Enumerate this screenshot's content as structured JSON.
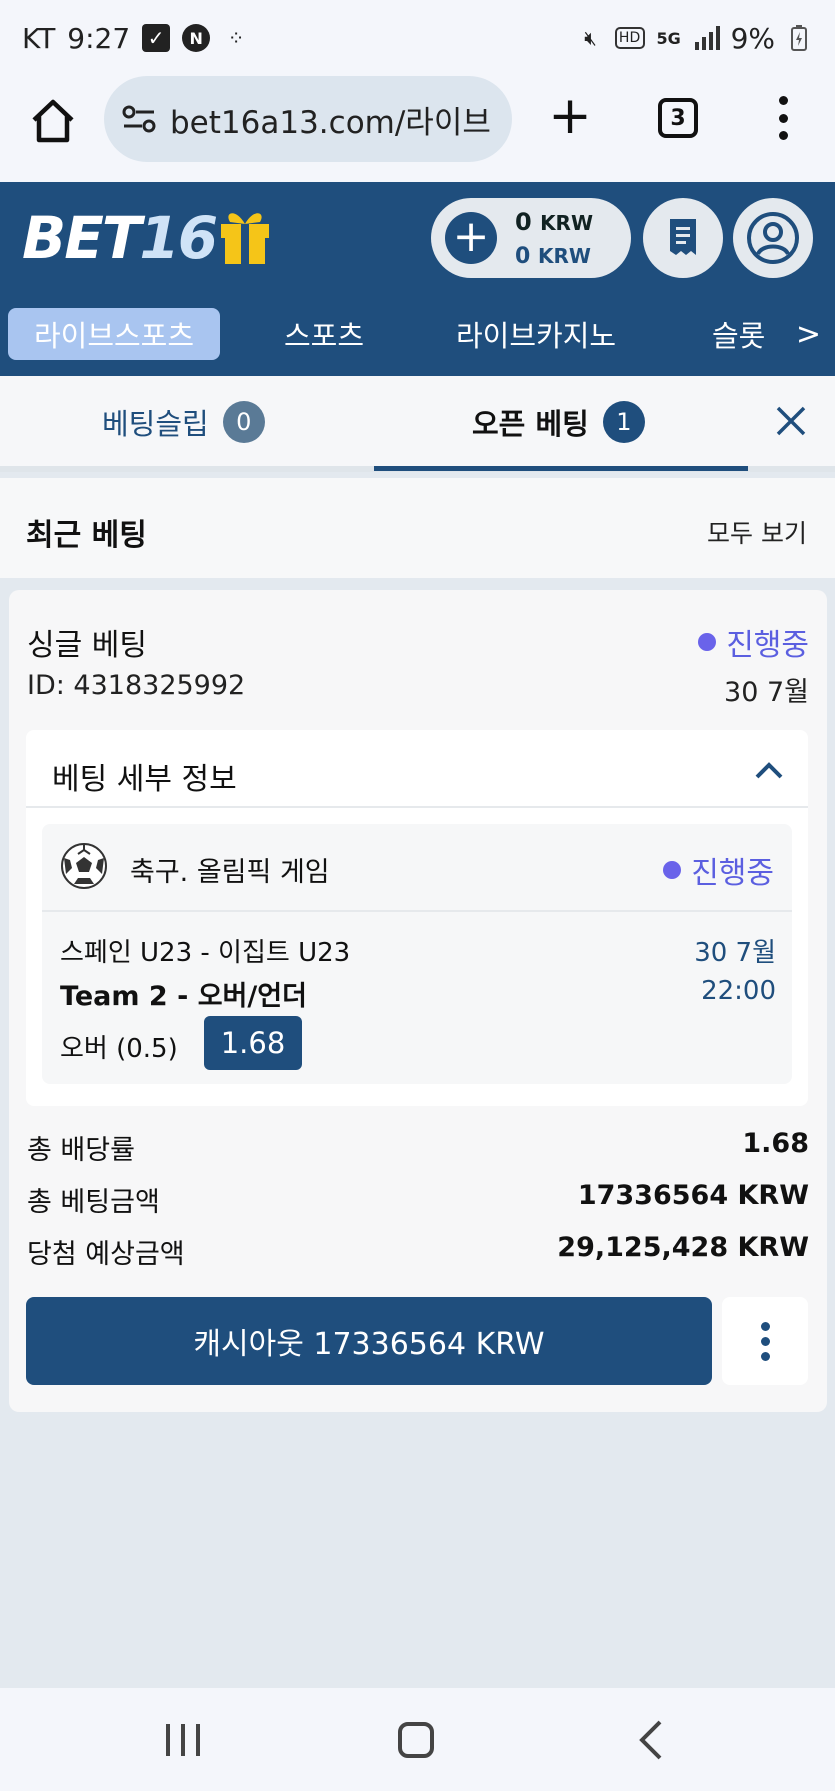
{
  "status_bar": {
    "carrier": "KT",
    "time": "9:27",
    "battery": "9%"
  },
  "browser": {
    "url": "bet16a13.com/라이브",
    "tab_count": "3"
  },
  "header": {
    "logo_text": "BET",
    "logo_number": "16",
    "balance_amount": "0",
    "balance_unit": "KRW",
    "bonus_amount": "0",
    "bonus_unit": "KRW"
  },
  "nav": {
    "items": [
      "라이브스포츠",
      "스포츠",
      "라이브카지노",
      "슬롯"
    ],
    "next": ">"
  },
  "tabs": {
    "slip_label": "베팅슬립",
    "slip_count": "0",
    "open_label": "오픈 베팅",
    "open_count": "1"
  },
  "recent": {
    "title": "최근 베팅",
    "view_all": "모두 보기"
  },
  "bet": {
    "type": "싱글 베팅",
    "status": "진행중",
    "id": "ID: 4318325992",
    "date": "30 7월",
    "details_title": "베팅 세부 정보",
    "event": {
      "sport": "축구. 올림픽 게임",
      "status": "진행중",
      "match": "스페인 U23 - 이집트 U23",
      "date": "30 7월",
      "market": "Team 2 - 오버/언더",
      "time": "22:00",
      "selection": "오버 (0.5)",
      "odds": "1.68"
    },
    "summary": [
      {
        "label": "총 배당률",
        "value": "1.68"
      },
      {
        "label": "총 베팅금액",
        "value": "17336564 KRW"
      },
      {
        "label": "당첨 예상금액",
        "value": "29,125,428 KRW"
      }
    ],
    "cashout_label": "캐시아웃 17336564 KRW"
  },
  "colors": {
    "brand": "#1f4e7d",
    "active_tab": "#a9c5f0",
    "status": "#5b5fe0"
  }
}
